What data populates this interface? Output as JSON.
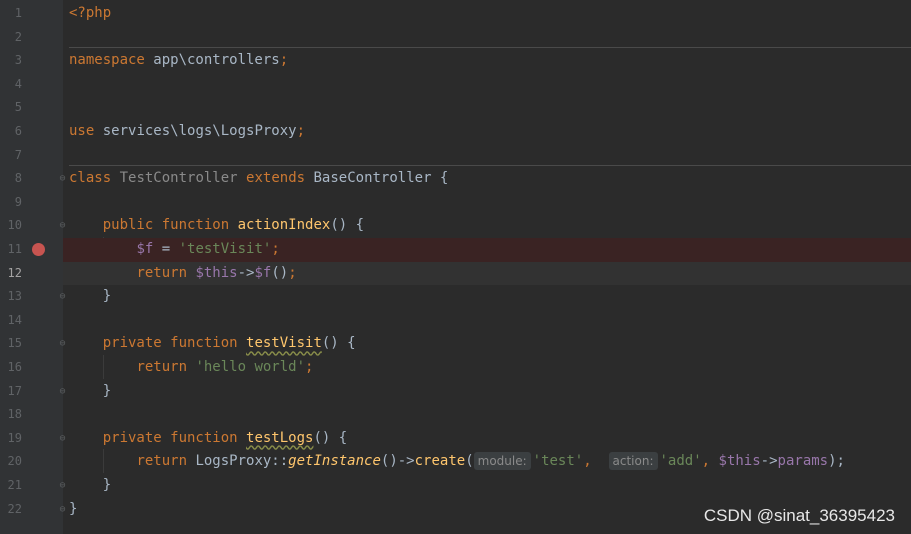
{
  "lines": [
    {
      "n": "1",
      "tokens": [
        {
          "t": "<?php",
          "c": "kw"
        }
      ]
    },
    {
      "n": "2",
      "tokens": []
    },
    {
      "n": "3",
      "tokens": [
        {
          "t": "namespace",
          "c": "kw"
        },
        {
          "t": " app\\controllers",
          "c": "pn"
        },
        {
          "t": ";",
          "c": "kw"
        }
      ]
    },
    {
      "n": "4",
      "tokens": []
    },
    {
      "n": "5",
      "tokens": []
    },
    {
      "n": "6",
      "tokens": [
        {
          "t": "use",
          "c": "kw"
        },
        {
          "t": " services\\logs\\LogsProxy",
          "c": "pn"
        },
        {
          "t": ";",
          "c": "kw"
        }
      ]
    },
    {
      "n": "7",
      "tokens": []
    },
    {
      "n": "8",
      "tokens": [
        {
          "t": "class",
          "c": "kw"
        },
        {
          "t": " ",
          "c": "pn"
        },
        {
          "t": "TestController",
          "c": "cls-dim"
        },
        {
          "t": " ",
          "c": "pn"
        },
        {
          "t": "extends",
          "c": "kw"
        },
        {
          "t": " BaseController {",
          "c": "pn"
        }
      ]
    },
    {
      "n": "9",
      "tokens": []
    },
    {
      "n": "10",
      "tokens": [
        {
          "t": "    ",
          "c": "pn"
        },
        {
          "t": "public function",
          "c": "kw"
        },
        {
          "t": " ",
          "c": "pn"
        },
        {
          "t": "actionIndex",
          "c": "fn"
        },
        {
          "t": "() {",
          "c": "pn"
        }
      ]
    },
    {
      "n": "11",
      "tokens": [
        {
          "t": "        ",
          "c": "pn"
        },
        {
          "t": "$f",
          "c": "var"
        },
        {
          "t": " = ",
          "c": "pn"
        },
        {
          "t": "'testVisit'",
          "c": "str"
        },
        {
          "t": ";",
          "c": "kw"
        }
      ]
    },
    {
      "n": "12",
      "tokens": [
        {
          "t": "        ",
          "c": "pn"
        },
        {
          "t": "return",
          "c": "kw"
        },
        {
          "t": " ",
          "c": "pn"
        },
        {
          "t": "$this",
          "c": "var"
        },
        {
          "t": "->",
          "c": "pn"
        },
        {
          "t": "$f",
          "c": "var"
        },
        {
          "t": "()",
          "c": "pn"
        },
        {
          "t": ";",
          "c": "kw"
        }
      ]
    },
    {
      "n": "13",
      "tokens": [
        {
          "t": "    }",
          "c": "pn"
        }
      ]
    },
    {
      "n": "14",
      "tokens": []
    },
    {
      "n": "15",
      "tokens": [
        {
          "t": "    ",
          "c": "pn"
        },
        {
          "t": "private function",
          "c": "kw"
        },
        {
          "t": " ",
          "c": "pn"
        },
        {
          "t": "testVisit",
          "c": "fn warn"
        },
        {
          "t": "() {",
          "c": "pn"
        }
      ]
    },
    {
      "n": "16",
      "tokens": [
        {
          "t": "        ",
          "c": "pn"
        },
        {
          "t": "return",
          "c": "kw"
        },
        {
          "t": " ",
          "c": "pn"
        },
        {
          "t": "'hello world'",
          "c": "str"
        },
        {
          "t": ";",
          "c": "kw"
        }
      ]
    },
    {
      "n": "17",
      "tokens": [
        {
          "t": "    }",
          "c": "pn"
        }
      ]
    },
    {
      "n": "18",
      "tokens": []
    },
    {
      "n": "19",
      "tokens": [
        {
          "t": "    ",
          "c": "pn"
        },
        {
          "t": "private function",
          "c": "kw"
        },
        {
          "t": " ",
          "c": "pn"
        },
        {
          "t": "testLogs",
          "c": "fn warn"
        },
        {
          "t": "() {",
          "c": "pn"
        }
      ]
    },
    {
      "n": "20",
      "tokens": [
        {
          "t": "        ",
          "c": "pn"
        },
        {
          "t": "return",
          "c": "kw"
        },
        {
          "t": " LogsProxy::",
          "c": "pn"
        },
        {
          "t": "getInstance",
          "c": "it"
        },
        {
          "t": "()->",
          "c": "pn"
        },
        {
          "t": "create",
          "c": "fn"
        },
        {
          "t": "(",
          "c": "pn"
        },
        {
          "t": "module:",
          "c": "hint"
        },
        {
          "t": "'test'",
          "c": "str"
        },
        {
          "t": ",  ",
          "c": "kw"
        },
        {
          "t": "action:",
          "c": "hint"
        },
        {
          "t": "'add'",
          "c": "str"
        },
        {
          "t": ", ",
          "c": "kw"
        },
        {
          "t": "$this",
          "c": "var"
        },
        {
          "t": "->",
          "c": "pn"
        },
        {
          "t": "params",
          "c": "var"
        },
        {
          "t": ");",
          "c": "pn"
        }
      ]
    },
    {
      "n": "21",
      "tokens": [
        {
          "t": "    }",
          "c": "pn"
        }
      ]
    },
    {
      "n": "22",
      "tokens": [
        {
          "t": "}",
          "c": "pn"
        }
      ]
    }
  ],
  "breakpoint_line": "11",
  "current_line": "12",
  "watermark": "CSDN @sinat_36395423"
}
